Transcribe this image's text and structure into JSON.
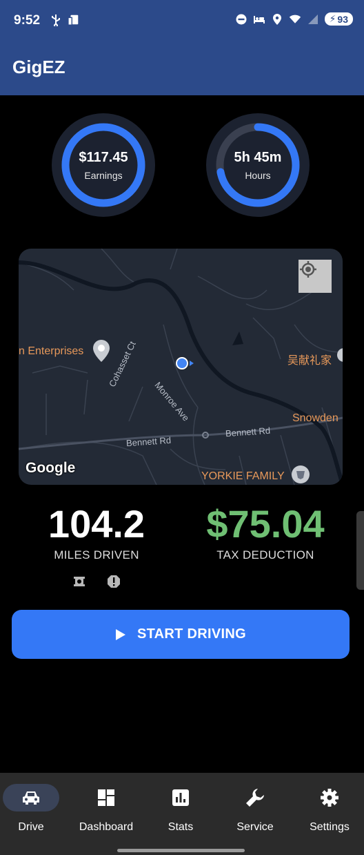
{
  "status_bar": {
    "time": "9:52",
    "battery": "93"
  },
  "app": {
    "title": "GigEZ"
  },
  "rings": {
    "earnings": {
      "value": "$117.45",
      "label": "Earnings",
      "progress": 1.0
    },
    "hours": {
      "value": "5h 45m",
      "label": "Hours",
      "progress": 0.72
    }
  },
  "map": {
    "places": {
      "enterprises": "n Enterprises",
      "chinese": "吴献礼家",
      "snowden": "Snowden",
      "yorkie": "YORKIE FAMILY"
    },
    "roads": {
      "cohasset": "Cohasset Ct",
      "monroe": "Monroe Ave",
      "bennett_left": "Bennett Rd",
      "bennett_right": "Bennett Rd"
    },
    "logo": "Google"
  },
  "stats": {
    "miles": {
      "value": "104.2",
      "label": "MILES DRIVEN"
    },
    "tax": {
      "value": "$75.04",
      "label": "TAX DEDUCTION"
    }
  },
  "start_button": {
    "label": "START DRIVING"
  },
  "nav": [
    {
      "label": "Drive",
      "icon": "car-icon",
      "active": true
    },
    {
      "label": "Dashboard",
      "icon": "dashboard-icon"
    },
    {
      "label": "Stats",
      "icon": "stats-icon"
    },
    {
      "label": "Service",
      "icon": "wrench-icon"
    },
    {
      "label": "Settings",
      "icon": "gear-icon"
    }
  ],
  "colors": {
    "header": "#2c4a8a",
    "accent": "#3478f6",
    "money": "#6fbf73",
    "place": "#e8995a"
  }
}
